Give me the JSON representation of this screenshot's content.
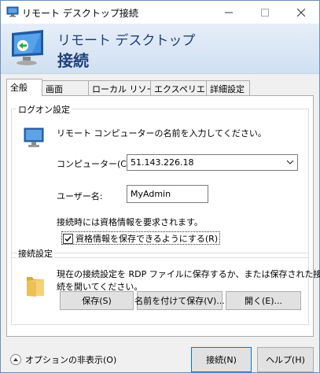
{
  "window": {
    "title": "リモート デスクトップ接続",
    "minimize_glyph": "—",
    "maximize_glyph": "☐",
    "close_glyph": "✕"
  },
  "banner": {
    "line1": "リモート デスクトップ",
    "line2": "接続"
  },
  "tabs": [
    {
      "label": "全般",
      "active": true
    },
    {
      "label": "画面"
    },
    {
      "label": "ローカル リソース"
    },
    {
      "label": "エクスペリエンス"
    },
    {
      "label": "詳細設定"
    }
  ],
  "logon": {
    "legend": "ログオン設定",
    "instruction": "リモート コンピューターの名前を入力してください。",
    "computer_label": "コンピューター(C):",
    "computer_value": "51.143.226.18",
    "user_label": "ユーザー名:",
    "user_value": "MyAdmin",
    "credentials_note": "接続時には資格情報を要求されます。",
    "save_credentials_label": "資格情報を保存できるようにする(R)",
    "save_credentials_checked": true
  },
  "connection": {
    "legend": "接続設定",
    "description_line1": "現在の接続設定を RDP ファイルに保存するか、または保存された接",
    "description_line2": "続を開いてください。",
    "save_button": "保存(S)",
    "save_as_button": "名前を付けて保存(V)...",
    "open_button": "開く(E)..."
  },
  "footer": {
    "options_label": "オプションの非表示(O)",
    "connect_button": "接続(N)",
    "help_button": "ヘルプ(H)"
  },
  "colors": {
    "accent": "#0078d7",
    "banner_text": "#1f3f7a"
  },
  "icons": [
    "app-icon",
    "rdp-logo-icon",
    "computer-icon",
    "folder-icon",
    "chevron-down-icon",
    "checkmark-icon",
    "collapse-up-icon"
  ]
}
